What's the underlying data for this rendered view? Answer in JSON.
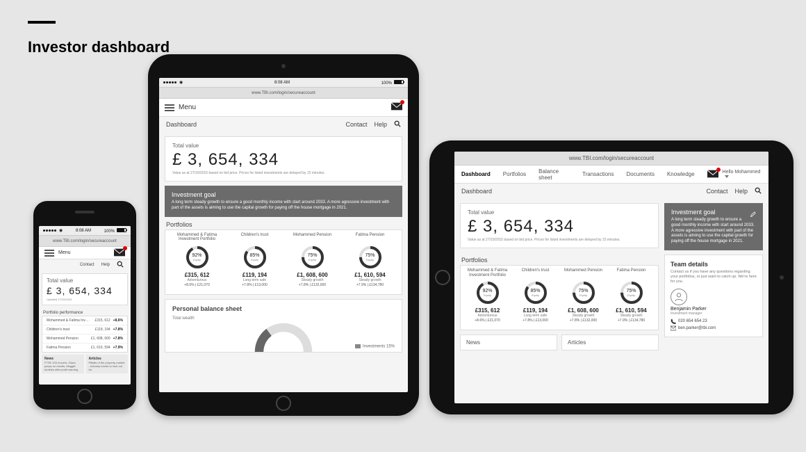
{
  "page": {
    "title": "Investor dashboard"
  },
  "status": {
    "time": "8:08 AM",
    "battery": "100%"
  },
  "url": "www.TBI.com/login/secureaccount",
  "menu_label": "Menu",
  "subnav": {
    "dashboard": "Dashboard",
    "contact": "Contact",
    "help": "Help"
  },
  "total": {
    "label": "Total value",
    "value": "£ 3, 654, 334",
    "note_tablet": "Value as at 27/10/2015 based on bid price. Prices for listed investments are delayed by 15 minutes.",
    "note_phone": "Updated 27/10/2015"
  },
  "goal": {
    "heading": "Investment goal",
    "text": "A long term steady growth to ensure a good monthly income with start around 2033. A more agressive investment with part of the assets is aiming to use the capital growth for paying off the house mortgage in 2021."
  },
  "portfolios_label": "Portfolios",
  "portfolio_perf_label": "Portfolio performance",
  "equity_label": "Equity",
  "portfolios": [
    {
      "name": "Mohammed & Fatima Investment Portfolio",
      "short": "Mohammed & Fatima Inv…",
      "pct": 92,
      "value": "£315, 612",
      "type": "Adventurous",
      "change": "+8.6%",
      "extra": "£21,070"
    },
    {
      "name": "Children's trust",
      "short": "Children's trust",
      "pct": 85,
      "value": "£119, 194",
      "type": "Long term safe",
      "change": "+7.8%",
      "extra": "£13,000"
    },
    {
      "name": "Mohammed Pension",
      "short": "Mohammed Pension",
      "pct": 75,
      "value": "£1, 608, 600",
      "type": "Steady growth",
      "change": "+7.8%",
      "extra": "£132,000"
    },
    {
      "name": "Fatima Pension",
      "short": "Fatima Pension",
      "pct": 75,
      "value": "£1, 610, 594",
      "type": "Steady growth",
      "change": "+7.9%",
      "extra": "£134,780"
    }
  ],
  "balance": {
    "heading": "Personal balance sheet",
    "wealth_label": "Total wealth",
    "legend": "Investments 15%"
  },
  "news": {
    "heading": "News",
    "phone_news": "FTSE 100 movers: Glaxo jumps on results, Meggitt tumbles after profit warning",
    "articles_heading": "Articles",
    "phone_articles": "Pitfalls of the property market - Industry trends to look out for"
  },
  "tabs": [
    "Dashboard",
    "Portfolios",
    "Balance sheet",
    "Transactions",
    "Documents",
    "Knowledge"
  ],
  "greeting": "Hello Mohammed",
  "team": {
    "heading": "Team details",
    "blurb": "Contact us if you have any questions regarding your portfolios, or just want to catch up. We're here for you.",
    "name": "Benjamin Parker",
    "role": "Investment manager",
    "phone": "020 654 654 23",
    "email": "ben.parker@tbi.com"
  },
  "chart_data": [
    {
      "type": "pie",
      "title": "Mohammed & Fatima Investment Portfolio",
      "slices": [
        {
          "name": "Equity",
          "value": 92
        },
        {
          "name": "Other",
          "value": 8
        }
      ]
    },
    {
      "type": "pie",
      "title": "Children's trust",
      "slices": [
        {
          "name": "Equity",
          "value": 85
        },
        {
          "name": "Other",
          "value": 15
        }
      ]
    },
    {
      "type": "pie",
      "title": "Mohammed Pension",
      "slices": [
        {
          "name": "Equity",
          "value": 75
        },
        {
          "name": "Other",
          "value": 25
        }
      ]
    },
    {
      "type": "pie",
      "title": "Fatima Pension",
      "slices": [
        {
          "name": "Equity",
          "value": 75
        },
        {
          "name": "Other",
          "value": 25
        }
      ]
    },
    {
      "type": "pie",
      "title": "Personal balance sheet",
      "slices": [
        {
          "name": "Investments",
          "value": 15
        },
        {
          "name": "Other",
          "value": 85
        }
      ]
    }
  ]
}
